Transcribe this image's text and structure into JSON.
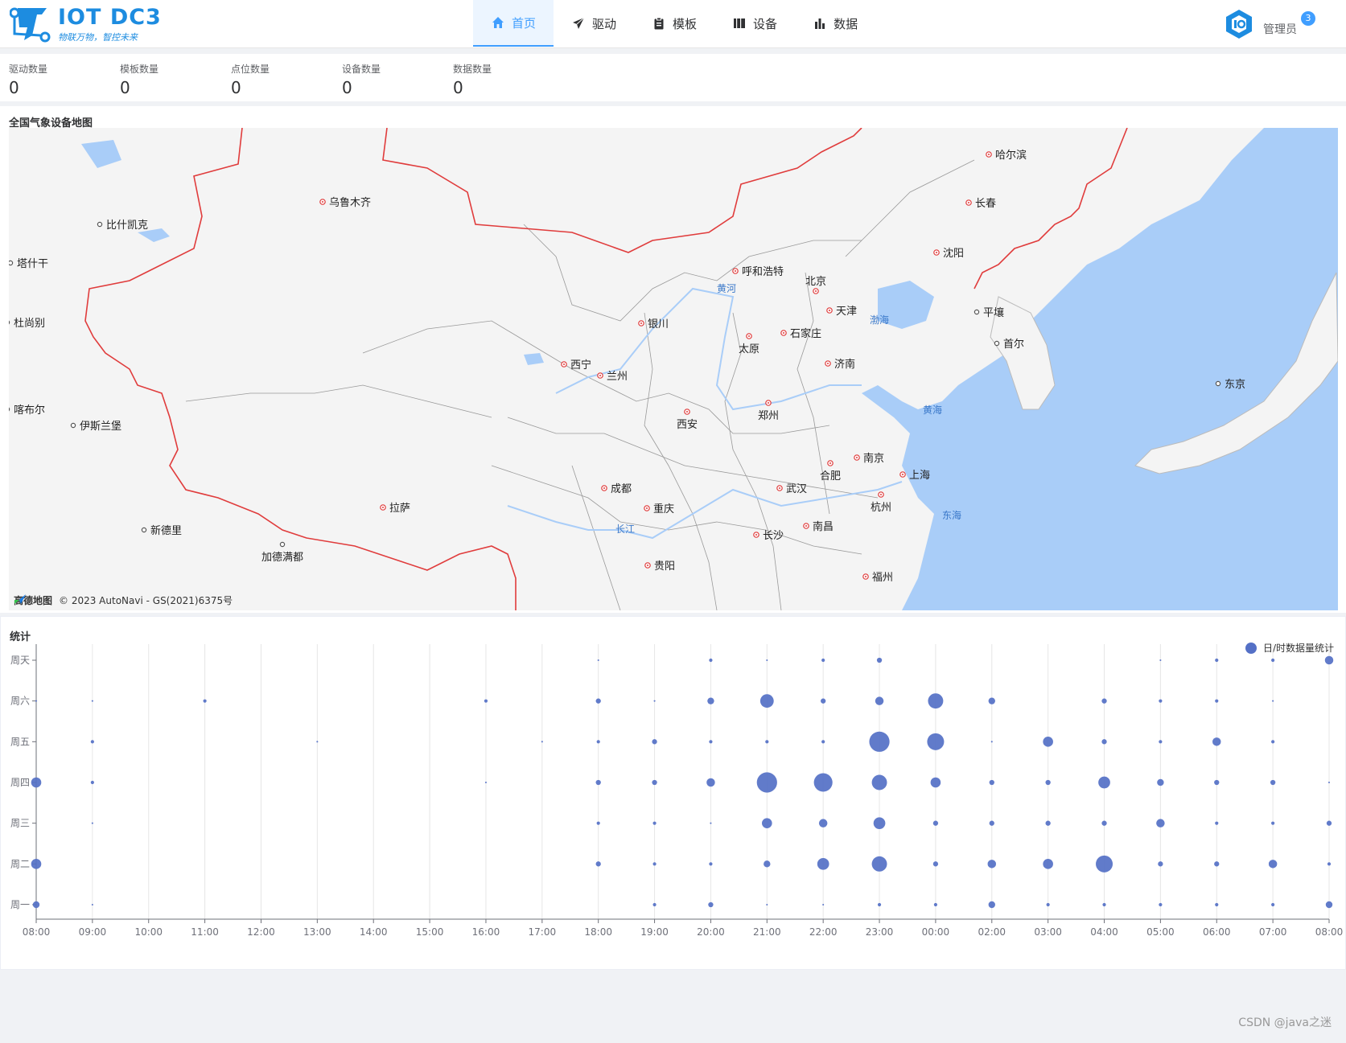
{
  "app": {
    "logo_title": "IOT DC3",
    "logo_subtitle": "物联万物，智控未来",
    "brand_color": "#1d8ce0",
    "accent_color": "#409eff"
  },
  "nav": [
    {
      "label": "首页",
      "icon": "home-icon",
      "active": true
    },
    {
      "label": "驱动",
      "icon": "send-icon",
      "active": false
    },
    {
      "label": "模板",
      "icon": "clipboard-icon",
      "active": false
    },
    {
      "label": "设备",
      "icon": "book-icon",
      "active": false
    },
    {
      "label": "数据",
      "icon": "bar-chart-icon",
      "active": false
    }
  ],
  "user": {
    "name": "管理员",
    "badge": "3",
    "avatar_icon": "iot-logo-icon"
  },
  "stats": [
    {
      "label": "驱动数量",
      "value": "0"
    },
    {
      "label": "模板数量",
      "value": "0"
    },
    {
      "label": "点位数量",
      "value": "0"
    },
    {
      "label": "设备数量",
      "value": "0"
    },
    {
      "label": "数据数量",
      "value": "0"
    }
  ],
  "map": {
    "title": "全国气象设备地图",
    "attribution_brand": "高德地图",
    "attribution_text": "© 2023 AutoNavi - GS(2021)6375号",
    "cities": [
      {
        "name": "乌鲁木齐",
        "capital": true
      },
      {
        "name": "比什凯克",
        "capital": false
      },
      {
        "name": "塔什干",
        "capital": false
      },
      {
        "name": "杜尚别",
        "capital": false
      },
      {
        "name": "喀布尔",
        "capital": false
      },
      {
        "name": "伊斯兰堡",
        "capital": false
      },
      {
        "name": "新德里",
        "capital": false
      },
      {
        "name": "加德满都",
        "capital": false
      },
      {
        "name": "拉萨",
        "capital": true
      },
      {
        "name": "西宁",
        "capital": true
      },
      {
        "name": "兰州",
        "capital": true
      },
      {
        "name": "银川",
        "capital": true
      },
      {
        "name": "呼和浩特",
        "capital": true
      },
      {
        "name": "北京",
        "capital": true
      },
      {
        "name": "天津",
        "capital": true
      },
      {
        "name": "石家庄",
        "capital": true
      },
      {
        "name": "太原",
        "capital": true
      },
      {
        "name": "济南",
        "capital": true
      },
      {
        "name": "西安",
        "capital": true
      },
      {
        "name": "郑州",
        "capital": true
      },
      {
        "name": "南京",
        "capital": true
      },
      {
        "name": "合肥",
        "capital": true
      },
      {
        "name": "上海",
        "capital": true
      },
      {
        "name": "武汉",
        "capital": true
      },
      {
        "name": "杭州",
        "capital": true
      },
      {
        "name": "成都",
        "capital": true
      },
      {
        "name": "重庆",
        "capital": true
      },
      {
        "name": "长沙",
        "capital": true
      },
      {
        "name": "南昌",
        "capital": true
      },
      {
        "name": "贵阳",
        "capital": true
      },
      {
        "name": "福州",
        "capital": true
      },
      {
        "name": "沈阳",
        "capital": true
      },
      {
        "name": "长春",
        "capital": true
      },
      {
        "name": "哈尔滨",
        "capital": true
      },
      {
        "name": "平壤",
        "capital": false
      },
      {
        "name": "首尔",
        "capital": false
      },
      {
        "name": "东京",
        "capital": false
      }
    ],
    "water": [
      "黄河",
      "长江",
      "渤海",
      "黄海",
      "东海"
    ]
  },
  "stats_chart": {
    "title": "统计",
    "legend": "日/时数据量统计",
    "color": "#5470c6"
  },
  "chart_data": {
    "type": "scatter",
    "title": "统计",
    "series": [
      {
        "name": "日/时数据量统计"
      }
    ],
    "x": [
      "08:00",
      "09:00",
      "10:00",
      "11:00",
      "12:00",
      "13:00",
      "14:00",
      "15:00",
      "16:00",
      "17:00",
      "18:00",
      "19:00",
      "20:00",
      "21:00",
      "22:00",
      "23:00",
      "00:00",
      "02:00",
      "03:00",
      "04:00",
      "05:00",
      "06:00",
      "07:00",
      "08:00"
    ],
    "y": [
      "周一",
      "周二",
      "周三",
      "周四",
      "周五",
      "周六",
      "周天"
    ],
    "points": [
      [
        0,
        0,
        4
      ],
      [
        1,
        0,
        1
      ],
      [
        11,
        0,
        2
      ],
      [
        12,
        0,
        3
      ],
      [
        13,
        0,
        1
      ],
      [
        14,
        0,
        1
      ],
      [
        15,
        0,
        2
      ],
      [
        16,
        0,
        2
      ],
      [
        17,
        0,
        4
      ],
      [
        18,
        0,
        2
      ],
      [
        19,
        0,
        2
      ],
      [
        20,
        0,
        2
      ],
      [
        21,
        0,
        2
      ],
      [
        22,
        0,
        2
      ],
      [
        23,
        0,
        4
      ],
      [
        0,
        1,
        6
      ],
      [
        10,
        1,
        3
      ],
      [
        11,
        1,
        2
      ],
      [
        12,
        1,
        2
      ],
      [
        13,
        1,
        4
      ],
      [
        14,
        1,
        7
      ],
      [
        15,
        1,
        9
      ],
      [
        16,
        1,
        3
      ],
      [
        17,
        1,
        5
      ],
      [
        18,
        1,
        6
      ],
      [
        19,
        1,
        10
      ],
      [
        20,
        1,
        3
      ],
      [
        21,
        1,
        3
      ],
      [
        22,
        1,
        5
      ],
      [
        23,
        1,
        2
      ],
      [
        1,
        2,
        1
      ],
      [
        10,
        2,
        2
      ],
      [
        11,
        2,
        2
      ],
      [
        12,
        2,
        1
      ],
      [
        13,
        2,
        6
      ],
      [
        14,
        2,
        5
      ],
      [
        15,
        2,
        7
      ],
      [
        16,
        2,
        3
      ],
      [
        17,
        2,
        3
      ],
      [
        18,
        2,
        3
      ],
      [
        19,
        2,
        3
      ],
      [
        20,
        2,
        5
      ],
      [
        21,
        2,
        2
      ],
      [
        22,
        2,
        2
      ],
      [
        23,
        2,
        3
      ],
      [
        0,
        3,
        6
      ],
      [
        1,
        3,
        2
      ],
      [
        8,
        3,
        1
      ],
      [
        10,
        3,
        3
      ],
      [
        11,
        3,
        3
      ],
      [
        12,
        3,
        5
      ],
      [
        13,
        3,
        12
      ],
      [
        14,
        3,
        11
      ],
      [
        15,
        3,
        9
      ],
      [
        16,
        3,
        6
      ],
      [
        17,
        3,
        3
      ],
      [
        18,
        3,
        3
      ],
      [
        19,
        3,
        7
      ],
      [
        20,
        3,
        4
      ],
      [
        21,
        3,
        3
      ],
      [
        22,
        3,
        3
      ],
      [
        23,
        3,
        1
      ],
      [
        1,
        4,
        2
      ],
      [
        5,
        4,
        1
      ],
      [
        9,
        4,
        1
      ],
      [
        10,
        4,
        2
      ],
      [
        11,
        4,
        3
      ],
      [
        12,
        4,
        2
      ],
      [
        13,
        4,
        2
      ],
      [
        14,
        4,
        2
      ],
      [
        15,
        4,
        12
      ],
      [
        16,
        4,
        10
      ],
      [
        17,
        4,
        1
      ],
      [
        18,
        4,
        6
      ],
      [
        19,
        4,
        3
      ],
      [
        20,
        4,
        2
      ],
      [
        21,
        4,
        5
      ],
      [
        22,
        4,
        2
      ],
      [
        0,
        5,
        1
      ],
      [
        1,
        5,
        1
      ],
      [
        3,
        5,
        2
      ],
      [
        8,
        5,
        2
      ],
      [
        10,
        5,
        3
      ],
      [
        11,
        5,
        1
      ],
      [
        12,
        5,
        4
      ],
      [
        13,
        5,
        8
      ],
      [
        14,
        5,
        3
      ],
      [
        15,
        5,
        5
      ],
      [
        16,
        5,
        9
      ],
      [
        17,
        5,
        4
      ],
      [
        19,
        5,
        3
      ],
      [
        20,
        5,
        2
      ],
      [
        21,
        5,
        2
      ],
      [
        22,
        5,
        1
      ],
      [
        10,
        6,
        1
      ],
      [
        12,
        6,
        2
      ],
      [
        13,
        6,
        1
      ],
      [
        14,
        6,
        2
      ],
      [
        15,
        6,
        3
      ],
      [
        20,
        6,
        1
      ],
      [
        21,
        6,
        2
      ],
      [
        22,
        6,
        2
      ],
      [
        23,
        6,
        5
      ]
    ]
  },
  "footer": {
    "watermark": "CSDN @java之迷"
  }
}
